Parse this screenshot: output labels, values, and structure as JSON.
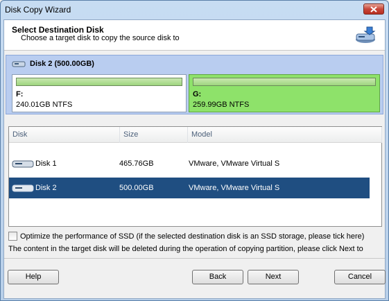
{
  "window": {
    "title": "Disk Copy Wizard"
  },
  "header": {
    "title": "Select Destination Disk",
    "subtitle": "Choose a target disk to copy the source disk to",
    "icon": "disk-copy-icon"
  },
  "destination": {
    "disk_label": "Disk 2 (500.00GB)",
    "partitions": [
      {
        "letter": "F:",
        "info": "240.01GB NTFS",
        "used_fraction": 1.0
      },
      {
        "letter": "G:",
        "info": "259.99GB NTFS",
        "used_fraction": 1.0
      }
    ]
  },
  "table": {
    "columns": [
      "Disk",
      "Size",
      "Model"
    ],
    "rows": [
      {
        "disk": "Disk 1",
        "size": "465.76GB",
        "model": "VMware, VMware Virtual S",
        "selected": false
      },
      {
        "disk": "Disk 2",
        "size": "500.00GB",
        "model": "VMware, VMware Virtual S",
        "selected": true
      }
    ]
  },
  "options": {
    "ssd_label": "Optimize the performance of SSD (if the selected destination disk is an SSD storage, please tick here)",
    "ssd_checked": false,
    "note": "The content in the target disk will be deleted during the operation of copying partition, please click Next to"
  },
  "buttons": {
    "help": "Help",
    "back": "Back",
    "next": "Next",
    "cancel": "Cancel"
  },
  "colors": {
    "selected_row": "#1f4e81",
    "selected_partition": "#8ee26a",
    "panel": "#b9cdf0"
  }
}
